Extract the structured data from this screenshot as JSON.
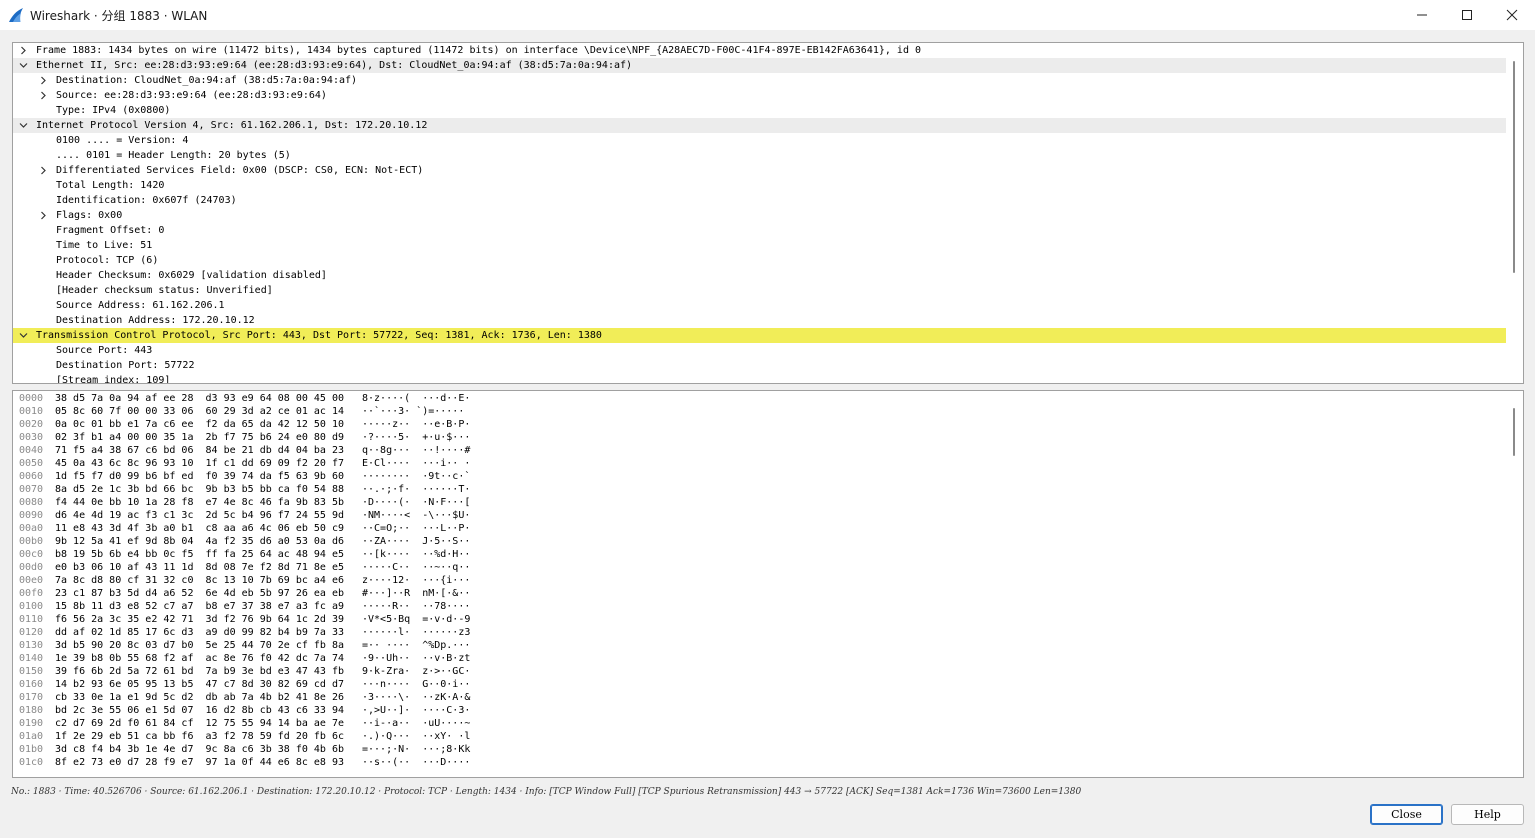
{
  "window": {
    "title": "Wireshark · 分组 1883 · WLAN"
  },
  "tree": [
    {
      "depth": 0,
      "arrow": "right",
      "text": "Frame 1883: 1434 bytes on wire (11472 bits), 1434 bytes captured (11472 bits) on interface \\Device\\NPF_{A28AEC7D-F00C-41F4-897E-EB142FA63641}, id 0"
    },
    {
      "depth": 0,
      "arrow": "down",
      "text": "Ethernet II, Src: ee:28:d3:93:e9:64 (ee:28:d3:93:e9:64), Dst: CloudNet_0a:94:af (38:d5:7a:0a:94:af)",
      "state": "expanded-head"
    },
    {
      "depth": 1,
      "arrow": "right",
      "text": "Destination: CloudNet_0a:94:af (38:d5:7a:0a:94:af)"
    },
    {
      "depth": 1,
      "arrow": "right",
      "text": "Source: ee:28:d3:93:e9:64 (ee:28:d3:93:e9:64)"
    },
    {
      "depth": 1,
      "arrow": "",
      "text": "Type: IPv4 (0x0800)"
    },
    {
      "depth": 0,
      "arrow": "down",
      "text": "Internet Protocol Version 4, Src: 61.162.206.1, Dst: 172.20.10.12",
      "state": "expanded-head"
    },
    {
      "depth": 1,
      "arrow": "",
      "text": "0100 .... = Version: 4"
    },
    {
      "depth": 1,
      "arrow": "",
      "text": ".... 0101 = Header Length: 20 bytes (5)"
    },
    {
      "depth": 1,
      "arrow": "right",
      "text": "Differentiated Services Field: 0x00 (DSCP: CS0, ECN: Not-ECT)"
    },
    {
      "depth": 1,
      "arrow": "",
      "text": "Total Length: 1420"
    },
    {
      "depth": 1,
      "arrow": "",
      "text": "Identification: 0x607f (24703)"
    },
    {
      "depth": 1,
      "arrow": "right",
      "text": "Flags: 0x00"
    },
    {
      "depth": 1,
      "arrow": "",
      "text": "Fragment Offset: 0"
    },
    {
      "depth": 1,
      "arrow": "",
      "text": "Time to Live: 51"
    },
    {
      "depth": 1,
      "arrow": "",
      "text": "Protocol: TCP (6)"
    },
    {
      "depth": 1,
      "arrow": "",
      "text": "Header Checksum: 0x6029 [validation disabled]"
    },
    {
      "depth": 1,
      "arrow": "",
      "text": "[Header checksum status: Unverified]"
    },
    {
      "depth": 1,
      "arrow": "",
      "text": "Source Address: 61.162.206.1"
    },
    {
      "depth": 1,
      "arrow": "",
      "text": "Destination Address: 172.20.10.12"
    },
    {
      "depth": 0,
      "arrow": "down",
      "text": "Transmission Control Protocol, Src Port: 443, Dst Port: 57722, Seq: 1381, Ack: 1736, Len: 1380",
      "state": "selected"
    },
    {
      "depth": 1,
      "arrow": "",
      "text": "Source Port: 443"
    },
    {
      "depth": 1,
      "arrow": "",
      "text": "Destination Port: 57722"
    },
    {
      "depth": 1,
      "arrow": "",
      "text": "[Stream index: 109]"
    }
  ],
  "bytes": [
    {
      "off": "0000",
      "hex": "38 d5 7a 0a 94 af ee 28  d3 93 e9 64 08 00 45 00",
      "ascii": "8·z····(  ···d··E·"
    },
    {
      "off": "0010",
      "hex": "05 8c 60 7f 00 00 33 06  60 29 3d a2 ce 01 ac 14",
      "ascii": "··`···3· `)=·····"
    },
    {
      "off": "0020",
      "hex": "0a 0c 01 bb e1 7a c6 ee  f2 da 65 da 42 12 50 10",
      "ascii": "·····z··  ··e·B·P·"
    },
    {
      "off": "0030",
      "hex": "02 3f b1 a4 00 00 35 1a  2b f7 75 b6 24 e0 80 d9",
      "ascii": "·?····5·  +·u·$···"
    },
    {
      "off": "0040",
      "hex": "71 f5 a4 38 67 c6 bd 06  84 be 21 db d4 04 ba 23",
      "ascii": "q··8g···  ··!····#"
    },
    {
      "off": "0050",
      "hex": "45 0a 43 6c 8c 96 93 10  1f c1 dd 69 09 f2 20 f7",
      "ascii": "E·Cl····  ···i·· ·"
    },
    {
      "off": "0060",
      "hex": "1d f5 f7 d0 99 b6 bf ed  f0 39 74 da f5 63 9b 60",
      "ascii": "········  ·9t··c·`"
    },
    {
      "off": "0070",
      "hex": "8a d5 2e 1c 3b bd 66 bc  9b b3 b5 bb ca f0 54 88",
      "ascii": "··.·;·f·  ······T·"
    },
    {
      "off": "0080",
      "hex": "f4 44 0e bb 10 1a 28 f8  e7 4e 8c 46 fa 9b 83 5b",
      "ascii": "·D····(·  ·N·F···["
    },
    {
      "off": "0090",
      "hex": "d6 4e 4d 19 ac f3 c1 3c  2d 5c b4 96 f7 24 55 9d",
      "ascii": "·NM····<  -\\···$U·"
    },
    {
      "off": "00a0",
      "hex": "11 e8 43 3d 4f 3b a0 b1  c8 aa a6 4c 06 eb 50 c9",
      "ascii": "··C=O;··  ···L··P·"
    },
    {
      "off": "00b0",
      "hex": "9b 12 5a 41 ef 9d 8b 04  4a f2 35 d6 a0 53 0a d6",
      "ascii": "··ZA····  J·5··S··"
    },
    {
      "off": "00c0",
      "hex": "b8 19 5b 6b e4 bb 0c f5  ff fa 25 64 ac 48 94 e5",
      "ascii": "··[k····  ··%d·H··"
    },
    {
      "off": "00d0",
      "hex": "e0 b3 06 10 af 43 11 1d  8d 08 7e f2 8d 71 8e e5",
      "ascii": "·····C··  ··~··q··"
    },
    {
      "off": "00e0",
      "hex": "7a 8c d8 80 cf 31 32 c0  8c 13 10 7b 69 bc a4 e6",
      "ascii": "z····12·  ···{i···"
    },
    {
      "off": "00f0",
      "hex": "23 c1 87 b3 5d d4 a6 52  6e 4d eb 5b 97 26 ea eb",
      "ascii": "#···]··R  nM·[·&··"
    },
    {
      "off": "0100",
      "hex": "15 8b 11 d3 e8 52 c7 a7  b8 e7 37 38 e7 a3 fc a9",
      "ascii": "·····R··  ··78····"
    },
    {
      "off": "0110",
      "hex": "f6 56 2a 3c 35 e2 42 71  3d f2 76 9b 64 1c 2d 39",
      "ascii": "·V*<5·Bq  =·v·d·-9"
    },
    {
      "off": "0120",
      "hex": "dd af 02 1d 85 17 6c d3  a9 d0 99 82 b4 b9 7a 33",
      "ascii": "······l·  ······z3"
    },
    {
      "off": "0130",
      "hex": "3d b5 90 20 8c 03 d7 b0  5e 25 44 70 2e cf fb 8a",
      "ascii": "=·· ····  ^%Dp.···"
    },
    {
      "off": "0140",
      "hex": "1e 39 b8 0b 55 68 f2 af  ac 8e 76 f0 42 dc 7a 74",
      "ascii": "·9··Uh··  ··v·B·zt"
    },
    {
      "off": "0150",
      "hex": "39 f6 6b 2d 5a 72 61 bd  7a b9 3e bd e3 47 43 fb",
      "ascii": "9·k-Zra·  z·>··GC·"
    },
    {
      "off": "0160",
      "hex": "14 b2 93 6e 05 95 13 b5  47 c7 8d 30 82 69 cd d7",
      "ascii": "···n····  G··0·i··"
    },
    {
      "off": "0170",
      "hex": "cb 33 0e 1a e1 9d 5c d2  db ab 7a 4b b2 41 8e 26",
      "ascii": "·3····\\·  ··zK·A·&"
    },
    {
      "off": "0180",
      "hex": "bd 2c 3e 55 06 e1 5d 07  16 d2 8b cb 43 c6 33 94",
      "ascii": "·,>U··]·  ····C·3·"
    },
    {
      "off": "0190",
      "hex": "c2 d7 69 2d f0 61 84 cf  12 75 55 94 14 ba ae 7e",
      "ascii": "··i-·a··  ·uU····~"
    },
    {
      "off": "01a0",
      "hex": "1f 2e 29 eb 51 ca bb f6  a3 f2 78 59 fd 20 fb 6c",
      "ascii": "·.)·Q···  ··xY· ·l"
    },
    {
      "off": "01b0",
      "hex": "3d c8 f4 b4 3b 1e 4e d7  9c 8a c6 3b 38 f0 4b 6b",
      "ascii": "=···;·N·  ···;8·Kk"
    },
    {
      "off": "01c0",
      "hex": "8f e2 73 e0 d7 28 f9 e7  97 1a 0f 44 e6 8c e8 93",
      "ascii": "··s··(··  ···D····"
    }
  ],
  "status": {
    "text": "No.: 1883 · Time: 40.526706 · Source: 61.162.206.1 · Destination: 172.20.10.12 · Protocol: TCP · Length: 1434 · Info: [TCP Window Full] [TCP Spurious Retransmission] 443 → 57722 [ACK] Seq=1381 Ack=1736 Win=73600 Len=1380"
  },
  "buttons": {
    "close": "Close",
    "help": "Help"
  },
  "colors": {
    "selected_row": "#f1ed58",
    "expanded_header_row": "#ececec",
    "app_icon": "#1c6bc4"
  },
  "icons": {
    "app": "wireshark-fin-icon",
    "minimize": "minimize-icon",
    "maximize": "maximize-icon",
    "close": "close-icon",
    "expand": "chevron-right-icon",
    "collapse": "chevron-down-icon"
  }
}
